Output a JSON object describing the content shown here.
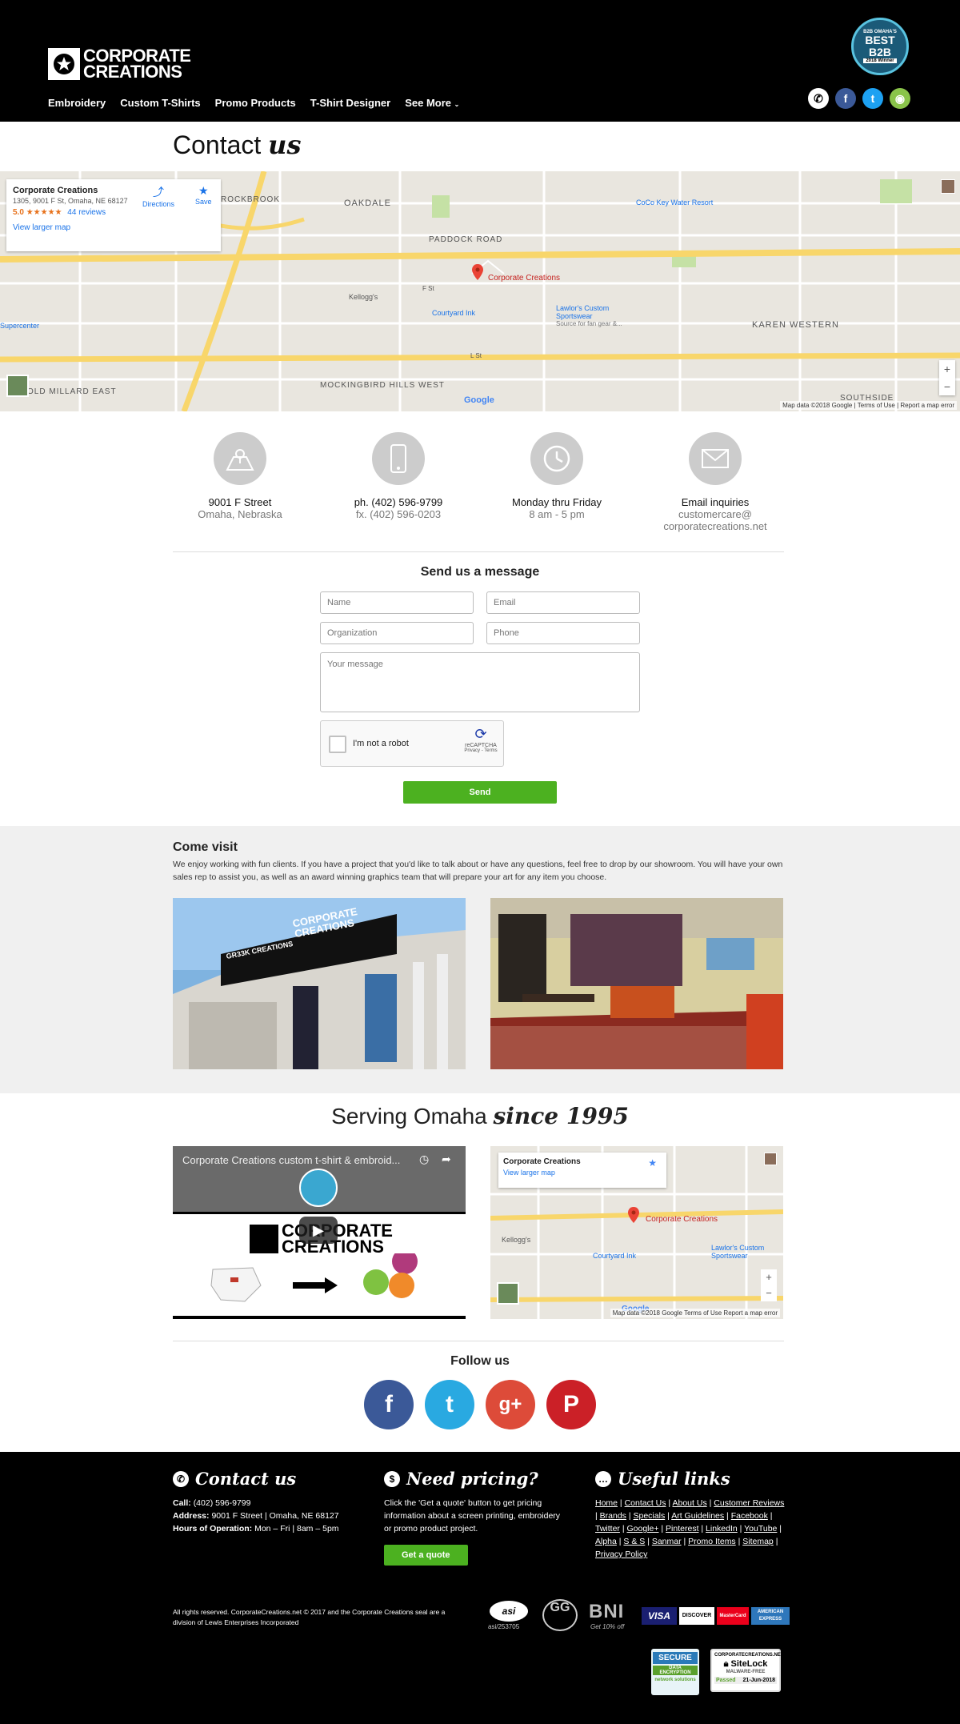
{
  "header": {
    "logo_line1": "CORPORATE",
    "logo_line2": "CREATIONS",
    "nav": [
      "Embroidery",
      "Custom T-Shirts",
      "Promo Products",
      "T-Shirt Designer",
      "See More"
    ],
    "badge_top": "B2B OMAHA'S",
    "badge_main": "BEST B2B",
    "badge_bottom": "2018 Winner"
  },
  "contact_heading": {
    "plain": "Contact",
    "script": "us"
  },
  "map": {
    "place_name": "Corporate Creations",
    "place_address": "1305, 9001 F St, Omaha, NE 68127",
    "rating": "5.0",
    "stars": "★★★★★",
    "reviews": "44 reviews",
    "view_larger": "View larger map",
    "directions": "Directions",
    "save": "Save",
    "pin_label": "Corporate Creations",
    "labels": {
      "rockbrook": "ROCKBROOK",
      "oakdale": "OAKDALE",
      "paddock": "PADDOCK ROAD",
      "coco": "CoCo Key Water Resort",
      "courtyard": "Courtyard Ink",
      "kelloggs": "Kellogg's",
      "lawlors": "Lawlor's Custom Sportswear",
      "lawlors_sub": "Source for fan gear &...",
      "karen": "KAREN WESTERN",
      "mockingbird": "MOCKINGBIRD HILLS",
      "mockingbird_west": "MOCKINGBIRD HILLS WEST",
      "southside": "SOUTHSIDE",
      "old_millard": "OLD MILLARD EAST",
      "supercenter": "Supercenter",
      "f_st": "F St",
      "l_st": "L St"
    },
    "footer": "Map data ©2018 Google  |  Terms of Use  |  Report a map error"
  },
  "info": [
    {
      "icon": "map-icon",
      "line1": "9001 F Street",
      "line2": "Omaha, Nebraska",
      "line3": ""
    },
    {
      "icon": "phone-icon",
      "line1": "ph. (402) 596-9799",
      "line2": "fx. (402) 596-0203",
      "line3": ""
    },
    {
      "icon": "clock-icon",
      "line1": "Monday thru Friday",
      "line2": "8 am - 5 pm",
      "line3": ""
    },
    {
      "icon": "mail-icon",
      "line1": "Email inquiries",
      "line2": "customercare@",
      "line3": "corporatecreations.net"
    }
  ],
  "form": {
    "title": "Send us a message",
    "name_ph": "Name",
    "email_ph": "Email",
    "org_ph": "Organization",
    "phone_ph": "Phone",
    "message_ph": "Your message",
    "captcha_label": "I'm not a robot",
    "captcha_brand": "reCAPTCHA",
    "captcha_links": "Privacy - Terms",
    "send": "Send"
  },
  "visit": {
    "title": "Come visit",
    "text": "We enjoy working with fun clients. If you have a project that you'd like to talk about or have any questions, feel free to drop by our showroom. You will have your own sales rep to assist you, as well as an award winning graphics team that will prepare your art for any item you choose.",
    "sign_text": "CORPORATE CREATIONS",
    "sign_sub": "GR33K CREATIONS"
  },
  "serving": {
    "plain": "Serving Omaha",
    "script": "since 1995"
  },
  "video": {
    "title": "Corporate Creations custom t-shirt & embroid...",
    "logo_line1": "CORPORATE",
    "logo_line2": "CREATIONS"
  },
  "map2": {
    "place_name": "Corporate Creations",
    "view_larger": "View larger map",
    "pin_label": "Corporate Creations",
    "kelloggs": "Kellogg's",
    "courtyard": "Courtyard Ink",
    "lawlors": "Lawlor's Custom Sportswear",
    "footer": "Map data ©2018 Google   Terms of Use   Report a map error"
  },
  "follow": {
    "title": "Follow us"
  },
  "footer": {
    "contact_title": "Contact us",
    "call_label": "Call:",
    "call_value": "(402) 596-9799",
    "address_label": "Address:",
    "address_value": "9001 F Street | Omaha, NE 68127",
    "hours_label": "Hours of Operation:",
    "hours_value": "Mon – Fri | 8am – 5pm",
    "pricing_title": "Need pricing?",
    "pricing_text": "Click the 'Get a quote' button to get pricing information about a screen printing, embroidery or promo product project.",
    "quote_button": "Get a quote",
    "links_title": "Useful links",
    "links": [
      "Home",
      "Contact Us",
      "About Us",
      "Customer Reviews",
      "Brands",
      "Specials",
      "Art Guidelines",
      "Facebook",
      "Twitter",
      "Google+",
      "Pinterest",
      "LinkedIn",
      "YouTube",
      "Alpha",
      "S & S",
      "Sanmar",
      "Promo Items",
      "Sitemap",
      "Privacy Policy"
    ],
    "copyright": "All rights reserved. CorporateCreations.net © 2017 and the Corporate Creations seal are a division of Lewis Enterprises Incorporated",
    "asi_label": "asi",
    "asi_number": "asi/253705",
    "bni_label": "BNI",
    "bni_sub": "Get 10% off",
    "cards": [
      "VISA",
      "DISCOVER",
      "MasterCard",
      "AMERICAN EXPRESS"
    ],
    "secure_label": "SECURE",
    "secure_sub": "DATA ENCRYPTION",
    "secure_network": "network solutions",
    "sitelock_site": "CORPORATECREATIONS.NET",
    "sitelock_name": "SiteLock",
    "sitelock_sub": "MALWARE-FREE",
    "sitelock_passed": "Passed",
    "sitelock_date": "21-Jun-2018"
  }
}
